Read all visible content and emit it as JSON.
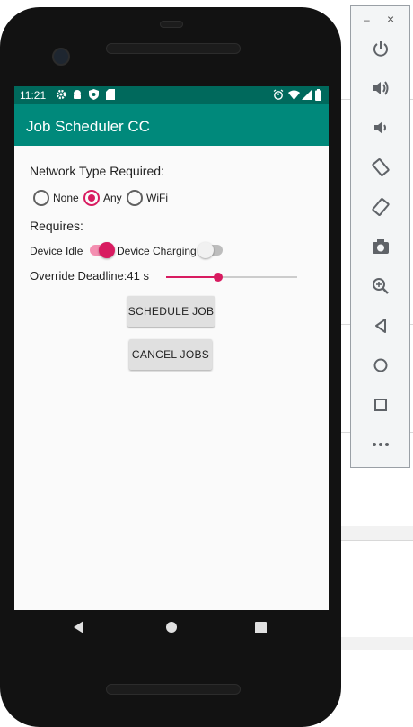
{
  "status_bar": {
    "time": "11:21"
  },
  "app_bar": {
    "title": "Job Scheduler CC"
  },
  "network": {
    "heading": "Network Type Required:",
    "options": [
      "None",
      "Any",
      "WiFi"
    ],
    "selected": "Any"
  },
  "requires": {
    "heading": "Requires:",
    "device_idle": {
      "label": "Device Idle",
      "on": true
    },
    "device_charging": {
      "label": "Device Charging",
      "on": false
    }
  },
  "deadline": {
    "label": "Override Deadline:41 s",
    "value_seconds": 41,
    "fraction": 0.4
  },
  "buttons": {
    "schedule": "SCHEDULE JOB",
    "cancel": "CANCEL JOBS"
  },
  "toolbar": {
    "minimize": "–",
    "close": "×",
    "icons": [
      "power-icon",
      "volume-up-icon",
      "volume-down-icon",
      "rotate-left-icon",
      "rotate-right-icon",
      "camera-icon",
      "zoom-icon",
      "back-icon",
      "home-icon",
      "overview-icon",
      "more-icon"
    ]
  },
  "colors": {
    "accent": "#d81b60",
    "primary": "#00897b",
    "primary_dark": "#00695c"
  }
}
